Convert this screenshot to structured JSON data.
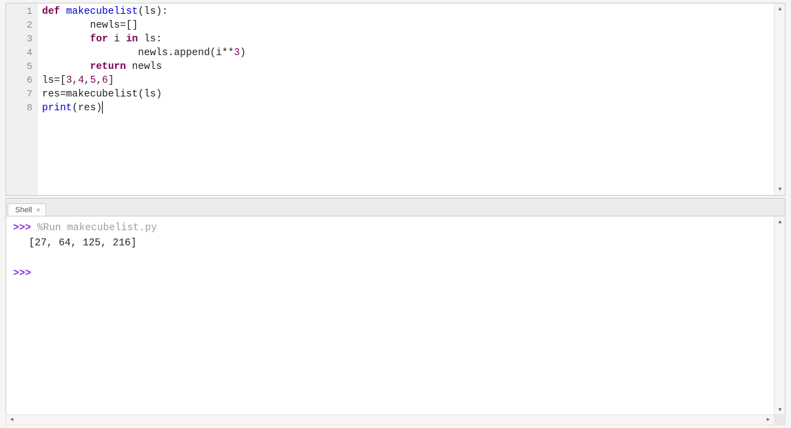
{
  "editor": {
    "line_numbers": [
      "1",
      "2",
      "3",
      "4",
      "5",
      "6",
      "7",
      "8"
    ],
    "lines": [
      {
        "tokens": [
          {
            "t": "def ",
            "c": "kw"
          },
          {
            "t": "makecubelist",
            "c": "fn"
          },
          {
            "t": "(ls):",
            "c": "plain"
          }
        ]
      },
      {
        "tokens": [
          {
            "t": "        newls=[]",
            "c": "plain"
          }
        ]
      },
      {
        "tokens": [
          {
            "t": "        ",
            "c": "plain"
          },
          {
            "t": "for",
            "c": "kw"
          },
          {
            "t": " i ",
            "c": "plain"
          },
          {
            "t": "in",
            "c": "kw"
          },
          {
            "t": " ls:",
            "c": "plain"
          }
        ]
      },
      {
        "tokens": [
          {
            "t": "                newls.append(i**",
            "c": "plain"
          },
          {
            "t": "3",
            "c": "num"
          },
          {
            "t": ")",
            "c": "plain"
          }
        ]
      },
      {
        "tokens": [
          {
            "t": "        ",
            "c": "plain"
          },
          {
            "t": "return",
            "c": "kw"
          },
          {
            "t": " newls",
            "c": "plain"
          }
        ]
      },
      {
        "tokens": [
          {
            "t": "ls=[",
            "c": "plain"
          },
          {
            "t": "3",
            "c": "num"
          },
          {
            "t": ",",
            "c": "plain"
          },
          {
            "t": "4",
            "c": "num"
          },
          {
            "t": ",",
            "c": "plain"
          },
          {
            "t": "5",
            "c": "num"
          },
          {
            "t": ",",
            "c": "plain"
          },
          {
            "t": "6",
            "c": "num"
          },
          {
            "t": "]",
            "c": "plain"
          }
        ]
      },
      {
        "tokens": [
          {
            "t": "res=makecubelist(ls)",
            "c": "plain"
          }
        ]
      },
      {
        "tokens": [
          {
            "t": "print",
            "c": "fn"
          },
          {
            "t": "(res)",
            "c": "plain"
          }
        ],
        "cursor": true
      }
    ]
  },
  "tab": {
    "label": "Shell",
    "close_glyph": "×"
  },
  "shell": {
    "lines": [
      {
        "type": "cmd",
        "prompt": ">>> ",
        "text": "%Run makecubelist.py"
      },
      {
        "type": "out",
        "text": "[27, 64, 125, 216]"
      },
      {
        "type": "out",
        "text": ""
      },
      {
        "type": "prompt",
        "prompt": ">>> ",
        "text": ""
      }
    ]
  },
  "scroll": {
    "up": "▴",
    "down": "▾",
    "left": "◂",
    "right": "▸"
  }
}
